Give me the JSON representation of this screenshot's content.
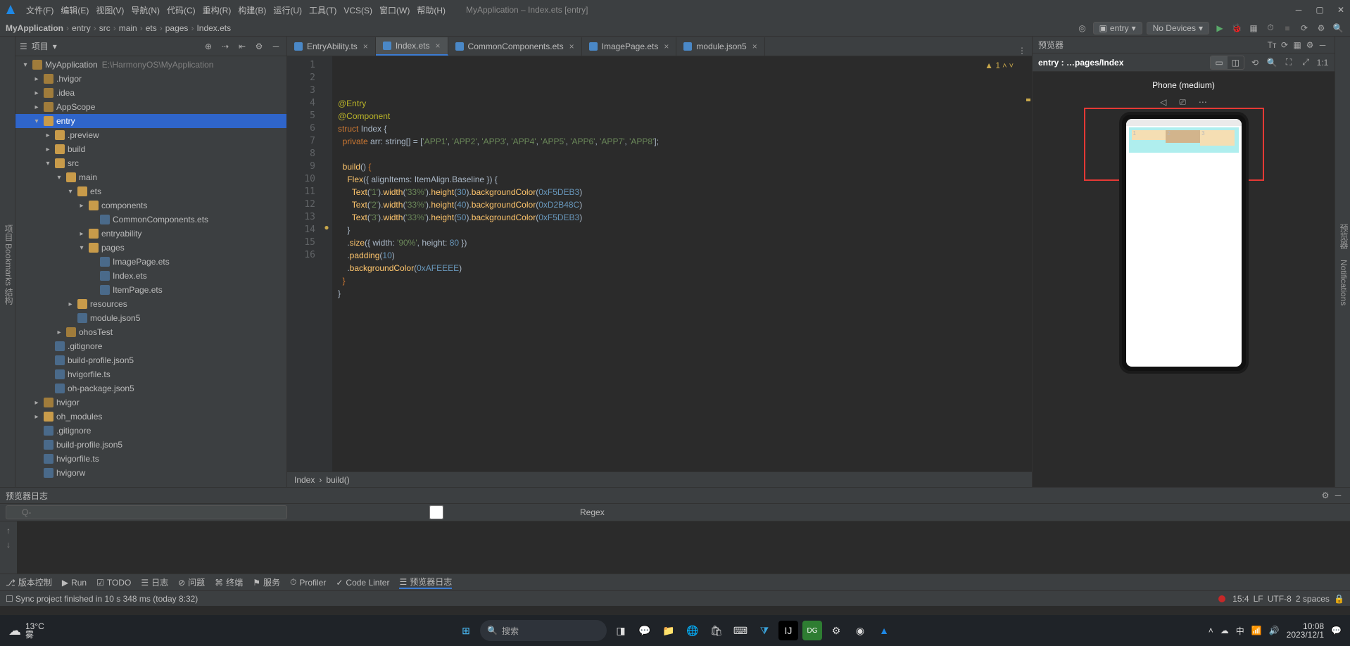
{
  "window": {
    "title": "MyApplication – Index.ets [entry]"
  },
  "menu": [
    "文件(F)",
    "编辑(E)",
    "视图(V)",
    "导航(N)",
    "代码(C)",
    "重构(R)",
    "构建(B)",
    "运行(U)",
    "工具(T)",
    "VCS(S)",
    "窗口(W)",
    "帮助(H)"
  ],
  "breadcrumb": [
    "MyApplication",
    "entry",
    "src",
    "main",
    "ets",
    "pages",
    "Index.ets"
  ],
  "toolbar_right": {
    "entry_label": "entry",
    "devices_label": "No Devices"
  },
  "project": {
    "title": "项目",
    "left_label": "项目",
    "tree": [
      {
        "d": 0,
        "o": true,
        "ic": "folder",
        "t": "MyApplication",
        "dim": "E:\\HarmonyOS\\MyApplication"
      },
      {
        "d": 1,
        "o": false,
        "ic": "folder",
        "t": ".hvigor"
      },
      {
        "d": 1,
        "o": false,
        "ic": "folder",
        "t": ".idea"
      },
      {
        "d": 1,
        "o": false,
        "ic": "folder",
        "t": "AppScope"
      },
      {
        "d": 1,
        "o": true,
        "ic": "folder-o",
        "t": "entry",
        "sel": true
      },
      {
        "d": 2,
        "o": false,
        "ic": "folder-o",
        "t": ".preview"
      },
      {
        "d": 2,
        "o": false,
        "ic": "folder-o",
        "t": "build"
      },
      {
        "d": 2,
        "o": true,
        "ic": "folder-o",
        "t": "src"
      },
      {
        "d": 3,
        "o": true,
        "ic": "folder-o",
        "t": "main"
      },
      {
        "d": 4,
        "o": true,
        "ic": "folder-o",
        "t": "ets"
      },
      {
        "d": 5,
        "o": false,
        "ic": "folder-o",
        "t": "components"
      },
      {
        "d": 6,
        "o": null,
        "ic": "file",
        "t": "CommonComponents.ets"
      },
      {
        "d": 5,
        "o": false,
        "ic": "folder-o",
        "t": "entryability"
      },
      {
        "d": 5,
        "o": true,
        "ic": "folder-o",
        "t": "pages"
      },
      {
        "d": 6,
        "o": null,
        "ic": "file",
        "t": "ImagePage.ets"
      },
      {
        "d": 6,
        "o": null,
        "ic": "file",
        "t": "Index.ets"
      },
      {
        "d": 6,
        "o": null,
        "ic": "file",
        "t": "ItemPage.ets"
      },
      {
        "d": 4,
        "o": false,
        "ic": "folder-o",
        "t": "resources"
      },
      {
        "d": 4,
        "o": null,
        "ic": "file",
        "t": "module.json5"
      },
      {
        "d": 3,
        "o": false,
        "ic": "folder",
        "t": "ohosTest"
      },
      {
        "d": 2,
        "o": null,
        "ic": "file",
        "t": ".gitignore"
      },
      {
        "d": 2,
        "o": null,
        "ic": "file",
        "t": "build-profile.json5"
      },
      {
        "d": 2,
        "o": null,
        "ic": "file",
        "t": "hvigorfile.ts"
      },
      {
        "d": 2,
        "o": null,
        "ic": "file",
        "t": "oh-package.json5"
      },
      {
        "d": 1,
        "o": false,
        "ic": "folder",
        "t": "hvigor"
      },
      {
        "d": 1,
        "o": false,
        "ic": "folder-o",
        "t": "oh_modules"
      },
      {
        "d": 1,
        "o": null,
        "ic": "file",
        "t": ".gitignore"
      },
      {
        "d": 1,
        "o": null,
        "ic": "file",
        "t": "build-profile.json5"
      },
      {
        "d": 1,
        "o": null,
        "ic": "file",
        "t": "hvigorfile.ts"
      },
      {
        "d": 1,
        "o": null,
        "ic": "file",
        "t": "hvigorw"
      }
    ]
  },
  "tabs": [
    {
      "label": "EntryAbility.ts"
    },
    {
      "label": "Index.ets",
      "active": true
    },
    {
      "label": "CommonComponents.ets"
    },
    {
      "label": "ImagePage.ets"
    },
    {
      "label": "module.json5"
    }
  ],
  "code": {
    "warn": "▲ 1",
    "lines": [
      {
        "n": 1,
        "h": "<span class='dec'>@Entry</span>"
      },
      {
        "n": 2,
        "h": "<span class='dec'>@Component</span>"
      },
      {
        "n": 3,
        "h": "<span class='kw'>struct</span> <span class='ty'>Index</span> {"
      },
      {
        "n": 4,
        "h": "  <span class='kw'>private</span> <span class='ty'>arr</span>: string[] = [<span class='str'>'APP1'</span>, <span class='str'>'APP2'</span>, <span class='str'>'APP3'</span>, <span class='str'>'APP4'</span>, <span class='str'>'APP5'</span>, <span class='str'>'APP6'</span>, <span class='str'>'APP7'</span>, <span class='str'>'APP8'</span>];"
      },
      {
        "n": 5,
        "h": ""
      },
      {
        "n": 6,
        "h": "  <span class='fn'>build</span>() <span class='kw'>{</span>"
      },
      {
        "n": 7,
        "h": "    <span class='fn'>Flex</span>({ alignItems: ItemAlign.Baseline }) {"
      },
      {
        "n": 8,
        "h": "      <span class='fn'>Text</span>(<span class='str'>'1'</span>).<span class='fn'>width</span>(<span class='str'>'33%'</span>).<span class='fn'>height</span>(<span class='num'>30</span>).<span class='fn'>backgroundColor</span>(<span class='num'>0xF5DEB3</span>)"
      },
      {
        "n": 9,
        "h": "      <span class='fn'>Text</span>(<span class='str'>'2'</span>).<span class='fn'>width</span>(<span class='str'>'33%'</span>).<span class='fn'>height</span>(<span class='num'>40</span>).<span class='fn'>backgroundColor</span>(<span class='num'>0xD2B48C</span>)"
      },
      {
        "n": 10,
        "h": "      <span class='fn'>Text</span>(<span class='str'>'3'</span>).<span class='fn'>width</span>(<span class='str'>'33%'</span>).<span class='fn'>height</span>(<span class='num'>50</span>).<span class='fn'>backgroundColor</span>(<span class='num'>0xF5DEB3</span>)"
      },
      {
        "n": 11,
        "h": "    }"
      },
      {
        "n": 12,
        "h": "    .<span class='fn'>size</span>({ width: <span class='str'>'90%'</span>, height: <span class='num'>80</span> })"
      },
      {
        "n": 13,
        "h": "    .<span class='fn'>padding</span>(<span class='num'>10</span>)"
      },
      {
        "n": 14,
        "h": "    .<span class='fn'>backgroundColor</span>(<span class='num'>0xAFEEEE</span>)"
      },
      {
        "n": 15,
        "h": "  <span class='kw'>}</span>"
      },
      {
        "n": 16,
        "h": "}"
      }
    ],
    "breadcrumb": [
      "Index",
      "build()"
    ]
  },
  "preview": {
    "title": "预览器",
    "path": "entry : …pages/Index",
    "device": "Phone (medium)",
    "right_label": "预览器",
    "notif_label": "Notifications",
    "demo": {
      "t1": "1",
      "t2": "2",
      "t3": "3"
    }
  },
  "log": {
    "title": "预览器日志",
    "search_ph": "Q-",
    "regex": "Regex"
  },
  "bottom_tools": [
    "版本控制",
    "Run",
    "TODO",
    "日志",
    "问题",
    "终端",
    "服务",
    "Profiler",
    "Code Linter",
    "预览器日志"
  ],
  "status": {
    "msg": "Sync project finished in 10 s 348 ms (today 8:32)",
    "pos": "15:4",
    "lf": "LF",
    "enc": "UTF-8",
    "indent": "2 spaces"
  },
  "taskbar": {
    "temp": "13°C",
    "cond": "雾",
    "search": "搜索",
    "ime": "中",
    "sound": "🔊",
    "clock_t": "10:08",
    "clock_d": "2023/12/1"
  }
}
